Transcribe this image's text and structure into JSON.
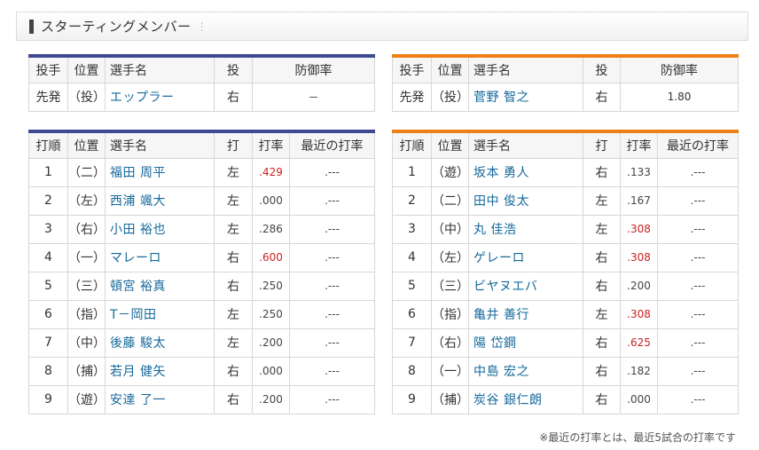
{
  "header": {
    "title": "スターティングメンバー"
  },
  "pitcher_headers": {
    "role": "投手",
    "pos": "位置",
    "name": "選手名",
    "throws": "投",
    "era": "防御率"
  },
  "batter_headers": {
    "order": "打順",
    "pos": "位置",
    "name": "選手名",
    "bats": "打",
    "avg": "打率",
    "recent": "最近の打率"
  },
  "left": {
    "pitcher": {
      "role": "先発",
      "pos": "（投）",
      "name": "エップラー",
      "throws": "右",
      "era": "－"
    },
    "batters": [
      {
        "order": "1",
        "pos": "（二）",
        "name": "福田 周平",
        "bats": "左",
        "avg": ".429",
        "hot": true,
        "recent": ".---"
      },
      {
        "order": "2",
        "pos": "（左）",
        "name": "西浦 颯大",
        "bats": "左",
        "avg": ".000",
        "hot": false,
        "recent": ".---"
      },
      {
        "order": "3",
        "pos": "（右）",
        "name": "小田 裕也",
        "bats": "左",
        "avg": ".286",
        "hot": false,
        "recent": ".---"
      },
      {
        "order": "4",
        "pos": "（一）",
        "name": "マレーロ",
        "bats": "右",
        "avg": ".600",
        "hot": true,
        "recent": ".---"
      },
      {
        "order": "5",
        "pos": "（三）",
        "name": "頓宮 裕真",
        "bats": "右",
        "avg": ".250",
        "hot": false,
        "recent": ".---"
      },
      {
        "order": "6",
        "pos": "（指）",
        "name": "T－岡田",
        "bats": "左",
        "avg": ".250",
        "hot": false,
        "recent": ".---"
      },
      {
        "order": "7",
        "pos": "（中）",
        "name": "後藤 駿太",
        "bats": "左",
        "avg": ".200",
        "hot": false,
        "recent": ".---"
      },
      {
        "order": "8",
        "pos": "（捕）",
        "name": "若月 健矢",
        "bats": "右",
        "avg": ".000",
        "hot": false,
        "recent": ".---"
      },
      {
        "order": "9",
        "pos": "（遊）",
        "name": "安達 了一",
        "bats": "右",
        "avg": ".200",
        "hot": false,
        "recent": ".---"
      }
    ]
  },
  "right": {
    "pitcher": {
      "role": "先発",
      "pos": "（投）",
      "name": "菅野 智之",
      "throws": "右",
      "era": "1.80"
    },
    "batters": [
      {
        "order": "1",
        "pos": "（遊）",
        "name": "坂本 勇人",
        "bats": "右",
        "avg": ".133",
        "hot": false,
        "recent": ".---"
      },
      {
        "order": "2",
        "pos": "（二）",
        "name": "田中 俊太",
        "bats": "左",
        "avg": ".167",
        "hot": false,
        "recent": ".---"
      },
      {
        "order": "3",
        "pos": "（中）",
        "name": "丸 佳浩",
        "bats": "左",
        "avg": ".308",
        "hot": true,
        "recent": ".---"
      },
      {
        "order": "4",
        "pos": "（左）",
        "name": "ゲレーロ",
        "bats": "右",
        "avg": ".308",
        "hot": true,
        "recent": ".---"
      },
      {
        "order": "5",
        "pos": "（三）",
        "name": "ビヤヌエバ",
        "bats": "右",
        "avg": ".200",
        "hot": false,
        "recent": ".---"
      },
      {
        "order": "6",
        "pos": "（指）",
        "name": "亀井 善行",
        "bats": "左",
        "avg": ".308",
        "hot": true,
        "recent": ".---"
      },
      {
        "order": "7",
        "pos": "（右）",
        "name": "陽 岱鋼",
        "bats": "右",
        "avg": ".625",
        "hot": true,
        "recent": ".---"
      },
      {
        "order": "8",
        "pos": "（一）",
        "name": "中島 宏之",
        "bats": "右",
        "avg": ".182",
        "hot": false,
        "recent": ".---"
      },
      {
        "order": "9",
        "pos": "（捕）",
        "name": "炭谷 銀仁朗",
        "bats": "右",
        "avg": ".000",
        "hot": false,
        "recent": ".---"
      }
    ]
  },
  "colors": {
    "left_accent": "#3f4a93",
    "right_accent": "#ee7f14",
    "hot_avg": "#cc2222",
    "link": "#16699b"
  },
  "footnote": "※最近の打率とは、最近5試合の打率です"
}
